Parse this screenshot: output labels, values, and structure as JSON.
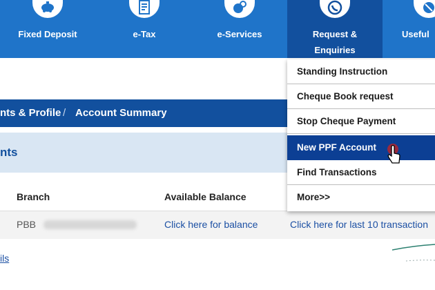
{
  "nav": {
    "items": [
      {
        "label": "Fixed Deposit",
        "icon": "piggy-bank-icon"
      },
      {
        "label": "e-Tax",
        "icon": "tax-document-icon"
      },
      {
        "label": "e-Services",
        "icon": "e-services-icon"
      },
      {
        "label": "Request &\nEnquiries",
        "icon": "request-enquiries-icon"
      },
      {
        "label": "Useful",
        "icon": "useful-links-icon"
      }
    ]
  },
  "breadcrumb": {
    "items": [
      "nts & Profile",
      "Account Summary"
    ],
    "separator": "/"
  },
  "section": {
    "title": "nts"
  },
  "table": {
    "headers": [
      "Branch",
      "Available Balance"
    ],
    "row": {
      "branch_prefix": "PBB",
      "balance_link": "Click here for balance",
      "transactions_link": "Click here for last 10 transaction"
    }
  },
  "footer_link": "ils",
  "dropdown": {
    "items": [
      "Standing Instruction",
      "Cheque Book request",
      "Stop Cheque Payment",
      "New PPF Account",
      "Find Transactions",
      "More>>"
    ],
    "hovered": "New PPF Account"
  },
  "colors": {
    "nav_bg": "#1f74c9",
    "nav_active": "#12509e",
    "crumb_bg": "#12509e",
    "section_bg": "#d9e6f3",
    "dropdown_hover": "#0c3f94",
    "link": "#1b4fa3"
  }
}
